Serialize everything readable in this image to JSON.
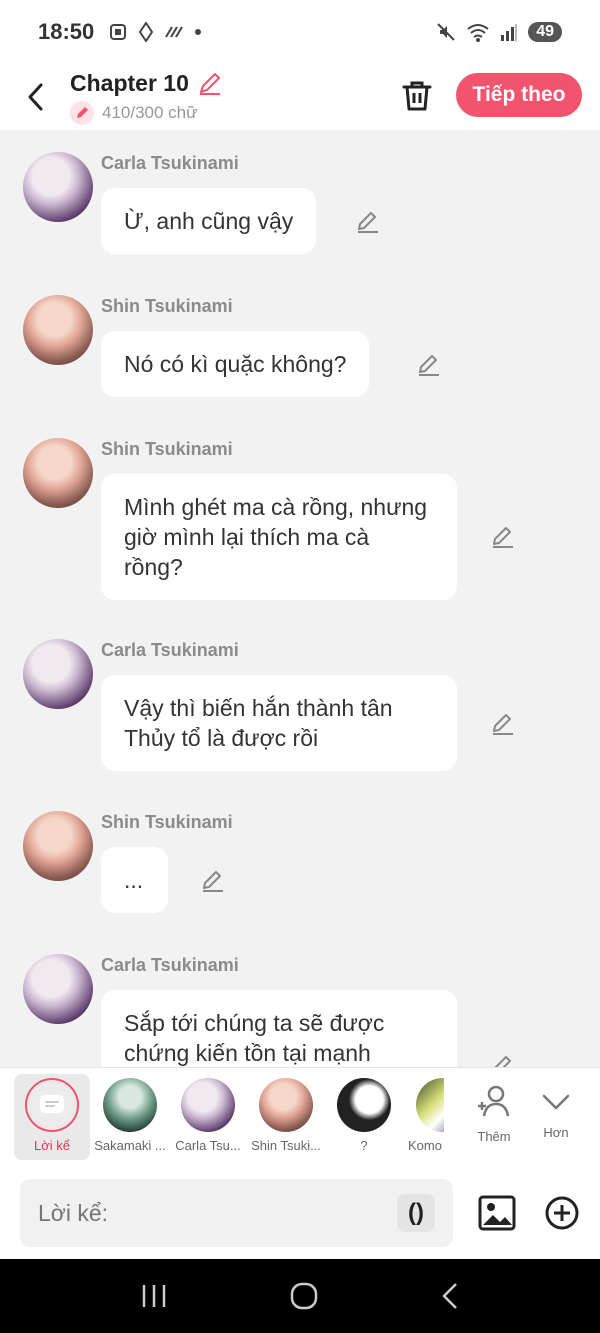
{
  "status": {
    "time": "18:50",
    "battery": "49"
  },
  "header": {
    "title": "Chapter 10",
    "word_count": "410/300 chữ",
    "next_label": "Tiếp theo"
  },
  "messages": [
    {
      "name": "Carla Tsukinami",
      "text": "Ừ, anh cũng vậy"
    },
    {
      "name": "Shin Tsukinami",
      "text": "Nó có kì quặc không?"
    },
    {
      "name": "Shin Tsukinami",
      "text": "Mình ghét ma cà rồng, nhưng giờ mình lại thích ma cà rồng?"
    },
    {
      "name": "Carla Tsukinami",
      "text": "Vậy thì biến hắn thành tân Thủy tổ là được rồi"
    },
    {
      "name": "Shin Tsukinami",
      "text": "..."
    },
    {
      "name": "Carla Tsukinami",
      "text": "Sắp tới chúng ta sẽ được chứng kiến tồn tại mạnh"
    }
  ],
  "characters": [
    {
      "label": "Lời kể"
    },
    {
      "label": "Sakamaki ..."
    },
    {
      "label": "Carla Tsu..."
    },
    {
      "label": "Shin Tsuki..."
    },
    {
      "label": "?"
    },
    {
      "label": "Komo"
    },
    {
      "label": "Thêm"
    },
    {
      "label": "Hơn"
    }
  ],
  "input": {
    "placeholder": "Lời kể:",
    "paren_label": "()"
  },
  "colors": {
    "accent": "#f2546e",
    "background": "#f2f2f2"
  }
}
